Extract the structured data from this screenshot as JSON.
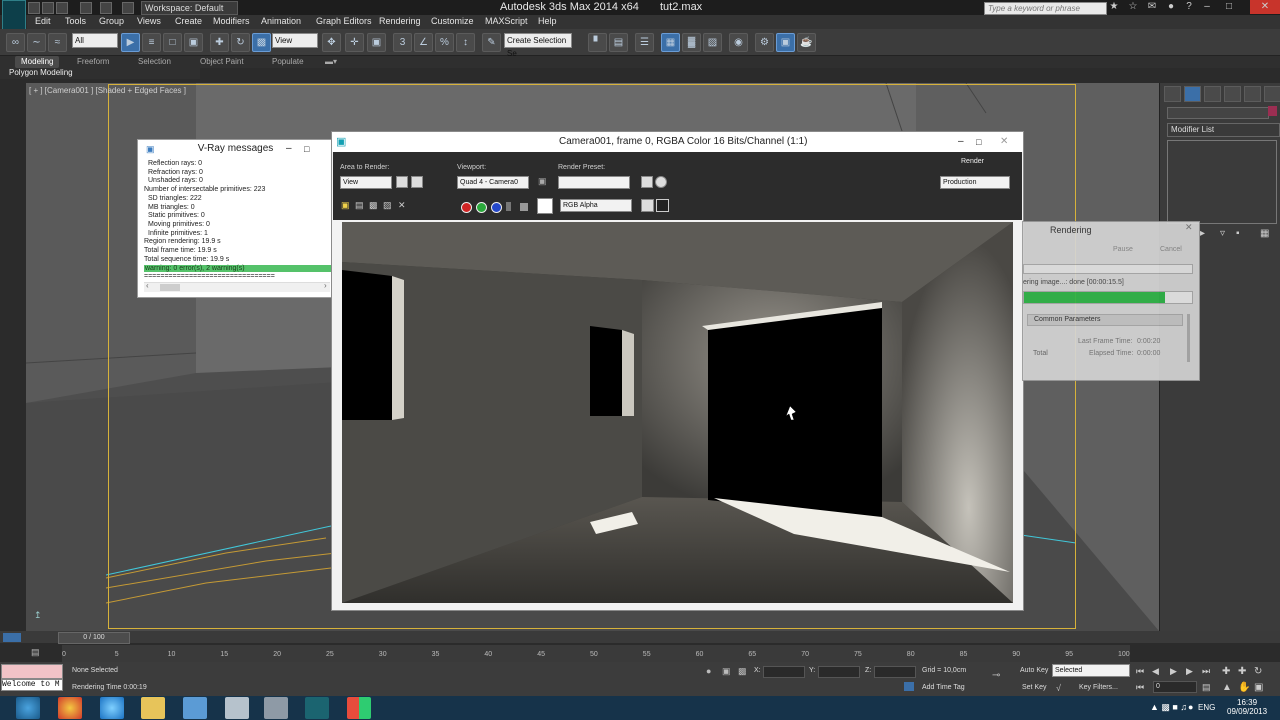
{
  "titlebar": {
    "app_title": "Autodesk 3ds Max  2014 x64",
    "file_name": "tut2.max",
    "workspace": "Workspace: Default",
    "search_placeholder": "Type a keyword or phrase"
  },
  "menu": [
    "Edit",
    "Tools",
    "Group",
    "Views",
    "Create",
    "Modifiers",
    "Animation",
    "Graph Editors",
    "Rendering",
    "Customize",
    "MAXScript",
    "Help"
  ],
  "toolbar": {
    "filter_value": "All",
    "ref_coord_value": "View",
    "selection_set_value": "Create Selection Se"
  },
  "ribbon": {
    "tabs": [
      "Modeling",
      "Freeform",
      "Selection",
      "Object Paint",
      "Populate"
    ],
    "selected_tab": "Modeling",
    "sub_label": "Polygon Modeling"
  },
  "viewport": {
    "label": "[ + ] [Camera001 ] [Shaded + Edged Faces ]"
  },
  "command_panel": {
    "modifier_list": "Modifier List"
  },
  "vray_messages": {
    "title": "V-Ray messages",
    "lines": [
      {
        "text": "Reflection rays: 0",
        "indent": true
      },
      {
        "text": "Refraction rays: 0",
        "indent": true
      },
      {
        "text": "Unshaded rays: 0",
        "indent": true
      },
      {
        "text": "Number of intersectable primitives: 223",
        "indent": false
      },
      {
        "text": "SD triangles: 222",
        "indent": true
      },
      {
        "text": "MB triangles: 0",
        "indent": true
      },
      {
        "text": "Static primitives: 0",
        "indent": true
      },
      {
        "text": "Moving primitives: 0",
        "indent": true
      },
      {
        "text": "Infinite primitives: 1",
        "indent": true
      },
      {
        "text": "Region rendering: 19.9 s",
        "indent": false
      },
      {
        "text": "Total frame time: 19.9 s",
        "indent": false
      },
      {
        "text": "Total sequence time: 19.9 s",
        "indent": false
      }
    ],
    "warning": "warning: 0 error(s), 2 warning(s)",
    "separator": "================================"
  },
  "frame_buffer": {
    "title": "Camera001, frame 0, RGBA Color 16 Bits/Channel (1:1)",
    "area_label": "Area to Render:",
    "area_value": "View",
    "viewport_label": "Viewport:",
    "viewport_value": "Quad 4 - Camera0",
    "preset_label": "Render Preset:",
    "preset_value": "",
    "render_button": "Render",
    "render_mode": "Production",
    "channel_value": "RGB Alpha"
  },
  "rendering_progress": {
    "title": "Rendering",
    "pause": "Pause",
    "cancel": "Cancel",
    "status": "ering image...: done [00:00:15.5]",
    "progress_fraction": 0.84,
    "section": "Common Parameters",
    "last_frame_label": "Last Frame Time:",
    "last_frame_value": "0:00:20",
    "total_label": "Total",
    "elapsed_label": "Elapsed Time:",
    "elapsed_value": "0:00:00"
  },
  "timeline": {
    "slider": "0 / 100",
    "ticks": [
      "0",
      "5",
      "10",
      "15",
      "20",
      "25",
      "30",
      "35",
      "40",
      "45",
      "50",
      "55",
      "60",
      "65",
      "70",
      "75",
      "80",
      "85",
      "90",
      "95",
      "100"
    ]
  },
  "status": {
    "welcome": "Welcome to M",
    "selection": "None Selected",
    "render_time": "Rendering Time 0:00:19",
    "x_label": "X:",
    "y_label": "Y:",
    "z_label": "Z:",
    "grid": "Grid = 10,0cm",
    "add_time_tag": "Add Time Tag",
    "auto_key": "Auto Key",
    "auto_key_value": "Selected",
    "set_key": "Set Key",
    "key_filters": "Key Filters...",
    "frame_value": "0"
  },
  "taskbar": {
    "language": "ENG",
    "time": "16:39",
    "date": "09/09/2013"
  }
}
